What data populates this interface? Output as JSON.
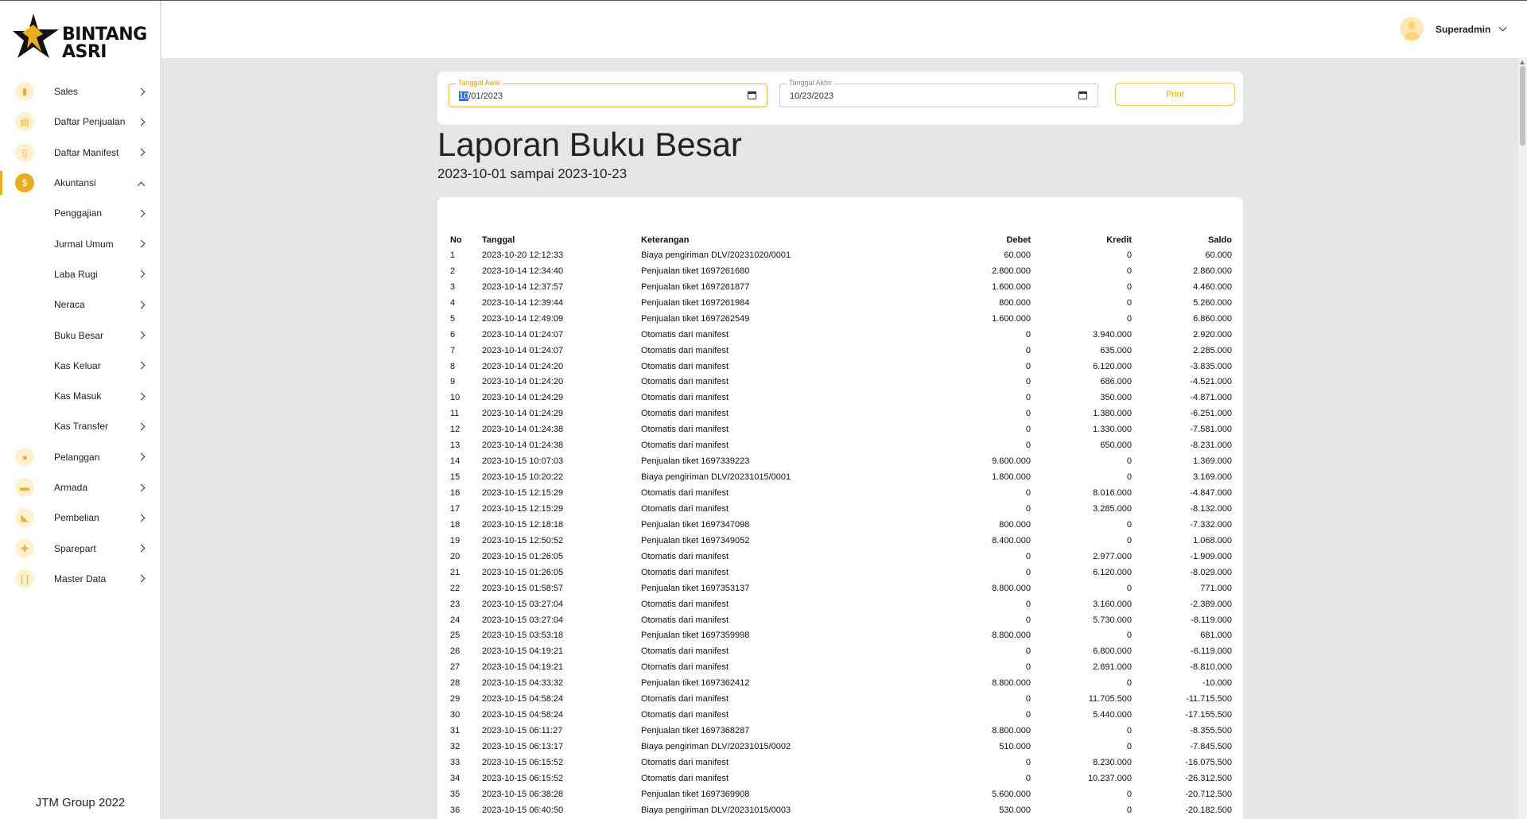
{
  "brand": {
    "line1": "BINTANG",
    "line2": "ASRI"
  },
  "sidebar": {
    "items": [
      {
        "label": "Sales",
        "icon": "bar-chart-icon",
        "glyph": "▮"
      },
      {
        "label": "Daftar Penjualan",
        "icon": "receipt-icon",
        "glyph": "▤"
      },
      {
        "label": "Daftar Manifest",
        "icon": "clipboard-icon",
        "glyph": "▯"
      },
      {
        "label": "Akuntansi",
        "icon": "dollar-icon",
        "glyph": "$",
        "active": true
      },
      {
        "label": "Penggajian",
        "sub": true
      },
      {
        "label": "Jurmal Umum",
        "sub": true
      },
      {
        "label": "Laba Rugi",
        "sub": true
      },
      {
        "label": "Neraca",
        "sub": true
      },
      {
        "label": "Buku Besar",
        "sub": true
      },
      {
        "label": "Kas Keluar",
        "sub": true
      },
      {
        "label": "Kas Masuk",
        "sub": true
      },
      {
        "label": "Kas Transfer",
        "sub": true
      },
      {
        "label": "Pelanggan",
        "icon": "people-icon",
        "glyph": "●"
      },
      {
        "label": "Armada",
        "icon": "bus-icon",
        "glyph": "▬"
      },
      {
        "label": "Pembelian",
        "icon": "cart-icon",
        "glyph": "◣"
      },
      {
        "label": "Sparepart",
        "icon": "puzzle-icon",
        "glyph": "✚"
      },
      {
        "label": "Master Data",
        "icon": "brackets-icon",
        "glyph": "[ ]"
      }
    ],
    "footer": "JTM Group 2022"
  },
  "header": {
    "username": "Superadmin"
  },
  "filter": {
    "start_label": "Tanggal Awal",
    "start_sel": "10",
    "start_rest": "/01/2023",
    "end_label": "Tanggal Akhir",
    "end_value": "10/23/2023",
    "print_label": "Print"
  },
  "report": {
    "title": "Laporan Buku Besar",
    "range": "2023-10-01 sampai 2023-10-23",
    "columns": [
      "No",
      "Tanggal",
      "Keterangan",
      "Debet",
      "Kredit",
      "Saldo"
    ],
    "rows": [
      [
        "1",
        "2023-10-20 12:12:33",
        "Biaya pengiriman DLV/20231020/0001",
        "60.000",
        "0",
        "60.000"
      ],
      [
        "2",
        "2023-10-14 12:34:40",
        "Penjualan tiket 1697261680",
        "2.800.000",
        "0",
        "2.860.000"
      ],
      [
        "3",
        "2023-10-14 12:37:57",
        "Penjualan tiket 1697261877",
        "1.600.000",
        "0",
        "4.460.000"
      ],
      [
        "4",
        "2023-10-14 12:39:44",
        "Penjualan tiket 1697261984",
        "800.000",
        "0",
        "5.260.000"
      ],
      [
        "5",
        "2023-10-14 12:49:09",
        "Penjualan tiket 1697262549",
        "1.600.000",
        "0",
        "6.860.000"
      ],
      [
        "6",
        "2023-10-14 01:24:07",
        "Otomatis dari manifest",
        "0",
        "3.940.000",
        "2.920.000"
      ],
      [
        "7",
        "2023-10-14 01:24:07",
        "Otomatis dari manifest",
        "0",
        "635.000",
        "2.285.000"
      ],
      [
        "8",
        "2023-10-14 01:24:20",
        "Otomatis dari manifest",
        "0",
        "6.120.000",
        "-3.835.000"
      ],
      [
        "9",
        "2023-10-14 01:24:20",
        "Otomatis dari manifest",
        "0",
        "686.000",
        "-4.521.000"
      ],
      [
        "10",
        "2023-10-14 01:24:29",
        "Otomatis dari manifest",
        "0",
        "350.000",
        "-4.871.000"
      ],
      [
        "11",
        "2023-10-14 01:24:29",
        "Otomatis dari manifest",
        "0",
        "1.380.000",
        "-6.251.000"
      ],
      [
        "12",
        "2023-10-14 01:24:38",
        "Otomatis dari manifest",
        "0",
        "1.330.000",
        "-7.581.000"
      ],
      [
        "13",
        "2023-10-14 01:24:38",
        "Otomatis dari manifest",
        "0",
        "650.000",
        "-8.231.000"
      ],
      [
        "14",
        "2023-10-15 10:07:03",
        "Penjualan tiket 1697339223",
        "9.600.000",
        "0",
        "1.369.000"
      ],
      [
        "15",
        "2023-10-15 10:20:22",
        "Biaya pengiriman DLV/20231015/0001",
        "1.800.000",
        "0",
        "3.169.000"
      ],
      [
        "16",
        "2023-10-15 12:15:29",
        "Otomatis dari manifest",
        "0",
        "8.016.000",
        "-4.847.000"
      ],
      [
        "17",
        "2023-10-15 12:15:29",
        "Otomatis dari manifest",
        "0",
        "3.285.000",
        "-8.132.000"
      ],
      [
        "18",
        "2023-10-15 12:18:18",
        "Penjualan tiket 1697347098",
        "800.000",
        "0",
        "-7.332.000"
      ],
      [
        "19",
        "2023-10-15 12:50:52",
        "Penjualan tiket 1697349052",
        "8.400.000",
        "0",
        "1.068.000"
      ],
      [
        "20",
        "2023-10-15 01:26:05",
        "Otomatis dari manifest",
        "0",
        "2.977.000",
        "-1.909.000"
      ],
      [
        "21",
        "2023-10-15 01:26:05",
        "Otomatis dari manifest",
        "0",
        "6.120.000",
        "-8.029.000"
      ],
      [
        "22",
        "2023-10-15 01:58:57",
        "Penjualan tiket 1697353137",
        "8.800.000",
        "0",
        "771.000"
      ],
      [
        "23",
        "2023-10-15 03:27:04",
        "Otomatis dari manifest",
        "0",
        "3.160.000",
        "-2.389.000"
      ],
      [
        "24",
        "2023-10-15 03:27:04",
        "Otomatis dari manifest",
        "0",
        "5.730.000",
        "-8.119.000"
      ],
      [
        "25",
        "2023-10-15 03:53:18",
        "Penjualan tiket 1697359998",
        "8.800.000",
        "0",
        "681.000"
      ],
      [
        "26",
        "2023-10-15 04:19:21",
        "Otomatis dari manifest",
        "0",
        "6.800.000",
        "-6.119.000"
      ],
      [
        "27",
        "2023-10-15 04:19:21",
        "Otomatis dari manifest",
        "0",
        "2.691.000",
        "-8.810.000"
      ],
      [
        "28",
        "2023-10-15 04:33:32",
        "Penjualan tiket 1697362412",
        "8.800.000",
        "0",
        "-10.000"
      ],
      [
        "29",
        "2023-10-15 04:58:24",
        "Otomatis dari manifest",
        "0",
        "11.705.500",
        "-11.715.500"
      ],
      [
        "30",
        "2023-10-15 04:58:24",
        "Otomatis dari manifest",
        "0",
        "5.440.000",
        "-17.155.500"
      ],
      [
        "31",
        "2023-10-15 06:11:27",
        "Penjualan tiket 1697368287",
        "8.800.000",
        "0",
        "-8.355.500"
      ],
      [
        "32",
        "2023-10-15 06:13:17",
        "Biaya pengiriman DLV/20231015/0002",
        "510.000",
        "0",
        "-7.845.500"
      ],
      [
        "33",
        "2023-10-15 06:15:52",
        "Otomatis dari manifest",
        "0",
        "8.230.000",
        "-16.075.500"
      ],
      [
        "34",
        "2023-10-15 06:15:52",
        "Otomatis dari manifest",
        "0",
        "10.237.000",
        "-26.312.500"
      ],
      [
        "35",
        "2023-10-15 06:38:28",
        "Penjualan tiket 1697369908",
        "5.600.000",
        "0",
        "-20.712.500"
      ],
      [
        "36",
        "2023-10-15 06:40:50",
        "Biaya pengiriman DLV/20231015/0003",
        "530.000",
        "0",
        "-20.182.500"
      ]
    ]
  },
  "colors": {
    "accent": "#e9ad1f",
    "accent_light": "#fdf1cf",
    "background": "#e6e6e6"
  }
}
